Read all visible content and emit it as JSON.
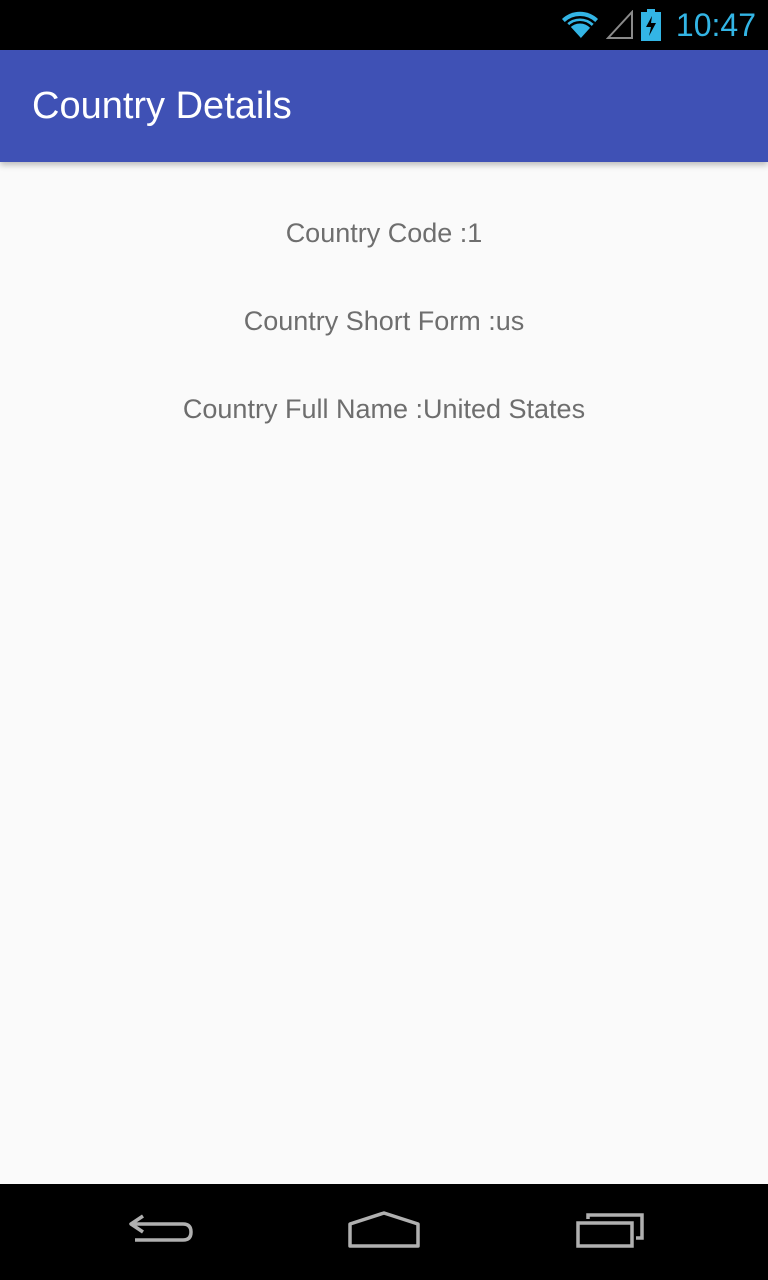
{
  "status_bar": {
    "time": "10:47",
    "icons": [
      "wifi-icon",
      "cell-signal-icon",
      "battery-charging-icon"
    ],
    "time_color": "#33b5e5"
  },
  "app_bar": {
    "title": "Country Details",
    "color": "#3f51b5"
  },
  "details": {
    "country_code": "Country Code :1",
    "short_form": "Country Short Form :us",
    "full_name": "Country Full Name :United States"
  },
  "nav_bar": {
    "icons": [
      "back-icon",
      "home-icon",
      "recents-icon"
    ]
  }
}
